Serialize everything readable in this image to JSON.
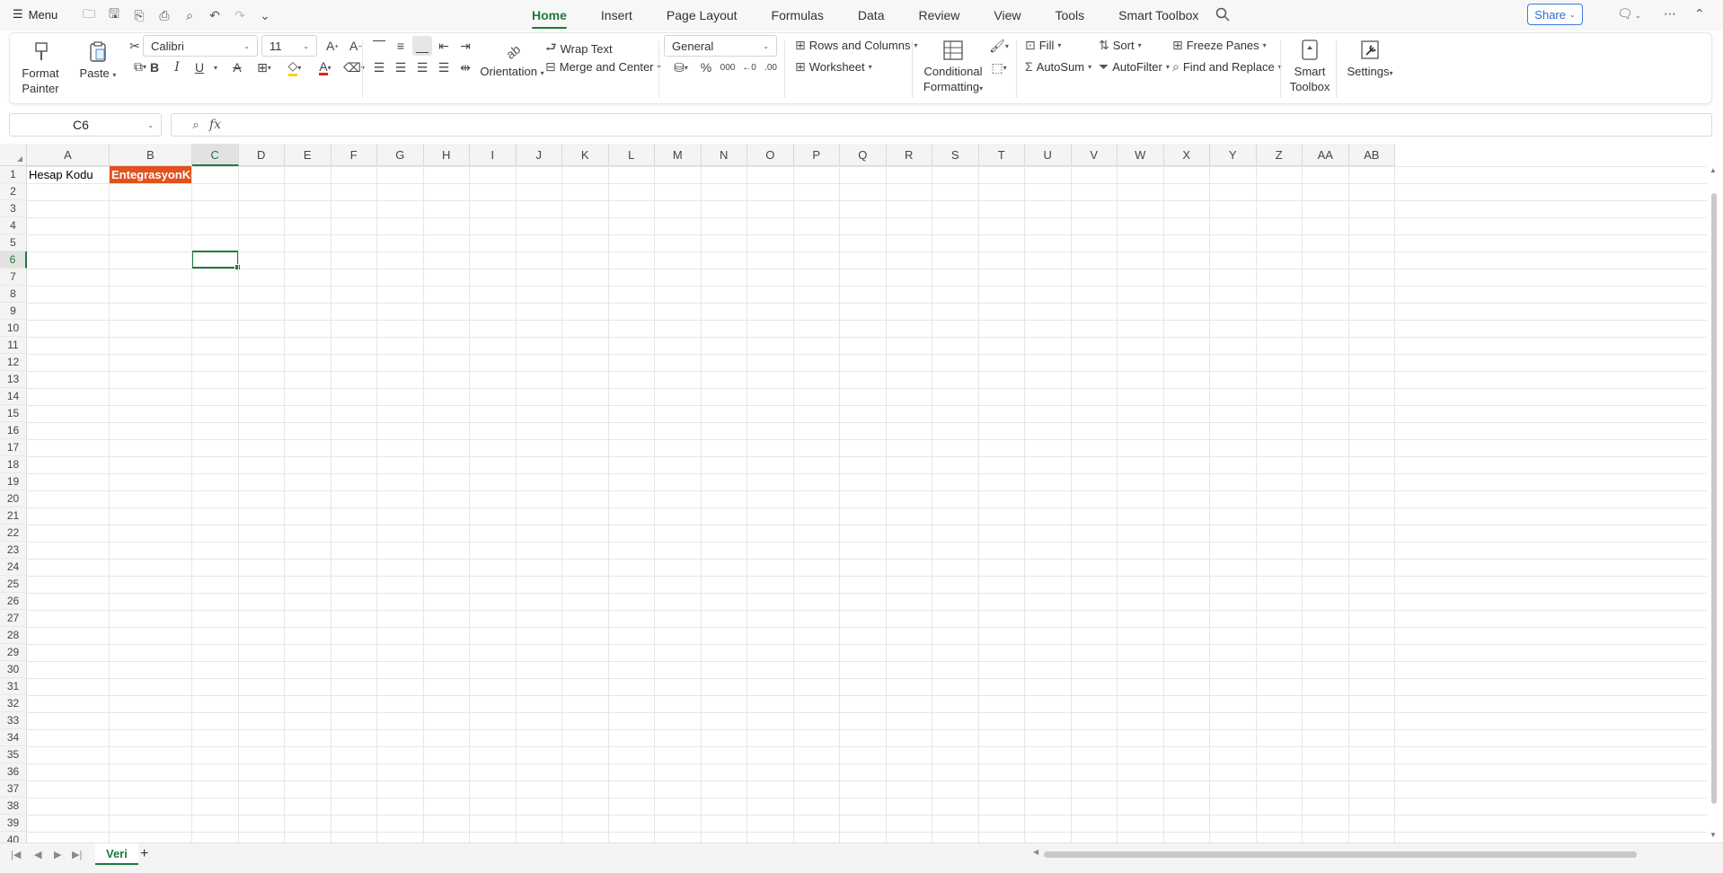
{
  "menubar": {
    "menu_label": "Menu",
    "tabs": [
      "Home",
      "Insert",
      "Page Layout",
      "Formulas",
      "Data",
      "Review",
      "View",
      "Tools",
      "Smart Toolbox"
    ],
    "active_tab": "Home",
    "share_label": "Share"
  },
  "ribbon": {
    "format_painter": "Format Painter",
    "format_painter_l1": "Format",
    "format_painter_l2": "Painter",
    "paste": "Paste",
    "font_name": "Calibri",
    "font_size": "11",
    "bold": "B",
    "italic": "I",
    "underline": "U",
    "wrap_text": "Wrap Text",
    "merge_center": "Merge and Center",
    "orientation": "Orientation",
    "number_format": "General",
    "rows_columns": "Rows and Columns",
    "worksheet": "Worksheet",
    "conditional_l1": "Conditional",
    "conditional_l2": "Formatting",
    "fill": "Fill",
    "sort": "Sort",
    "freeze_panes": "Freeze Panes",
    "autosum": "AutoSum",
    "autofilter": "AutoFilter",
    "find_replace": "Find and Replace",
    "smart_toolbox_l1": "Smart",
    "smart_toolbox_l2": "Toolbox",
    "settings": "Settings"
  },
  "formula_bar": {
    "name_box": "C6",
    "fx": "fx",
    "formula": ""
  },
  "grid": {
    "columns": [
      "A",
      "B",
      "C",
      "D",
      "E",
      "F",
      "G",
      "H",
      "I",
      "J",
      "K",
      "L",
      "M",
      "N",
      "O",
      "P",
      "Q",
      "R",
      "S",
      "T",
      "U",
      "V",
      "W",
      "X",
      "Y",
      "Z",
      "AA",
      "AB"
    ],
    "rows": [
      "1",
      "2",
      "3",
      "4",
      "5",
      "6",
      "7",
      "8",
      "9",
      "10",
      "11",
      "12",
      "13",
      "14",
      "15",
      "16",
      "17",
      "18",
      "19",
      "20",
      "21",
      "22",
      "23",
      "24",
      "25",
      "26",
      "27",
      "28",
      "29",
      "30",
      "31",
      "32",
      "33",
      "34",
      "35",
      "36",
      "37",
      "38",
      "39",
      "40"
    ],
    "selected_column": "C",
    "selected_row": "6",
    "cells": {
      "A1": "Hesap Kodu",
      "B1": "EntegrasyonKodu"
    },
    "b1_fill_color": "#e0521e"
  },
  "sheets": {
    "tabs": [
      "Veri"
    ],
    "active": "Veri"
  },
  "colors": {
    "accent": "#1f7a3f",
    "share_blue": "#2e6bd6"
  }
}
